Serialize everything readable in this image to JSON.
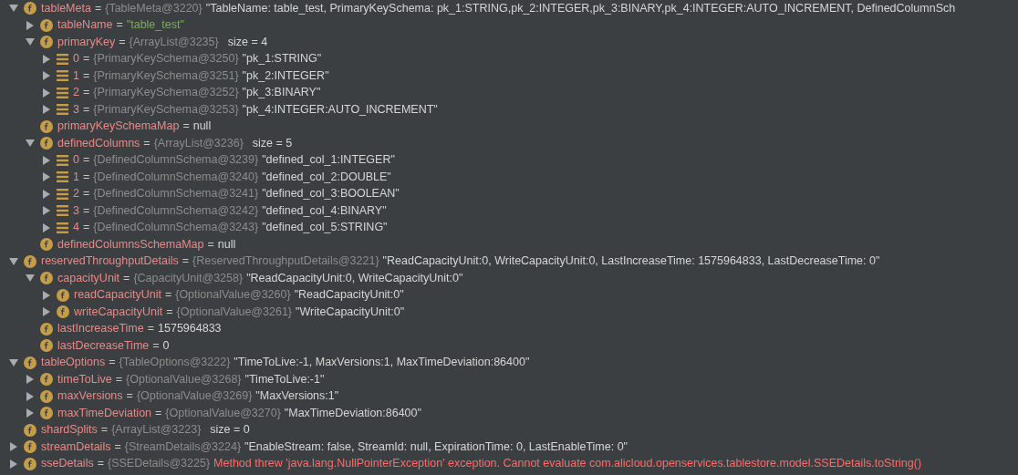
{
  "variables": [
    {
      "name": "tableMeta",
      "kind": "field",
      "expanded": true,
      "separator": "=",
      "type": "{TableMeta@3220}",
      "value": {
        "kind": "string",
        "text": "\"TableName: table_test, PrimaryKeySchema: pk_1:STRING,pk_2:INTEGER,pk_3:BINARY,pk_4:INTEGER:AUTO_INCREMENT, DefinedColumnSch"
      },
      "children": [
        {
          "name": "tableName",
          "kind": "field",
          "expanded": false,
          "separator": "=",
          "value": {
            "kind": "literal",
            "text": "\"table_test\""
          }
        },
        {
          "name": "primaryKey",
          "kind": "field",
          "expanded": true,
          "separator": "=",
          "type": "{ArrayList@3235}",
          "value": {
            "kind": "size",
            "text": "size = 4"
          },
          "children": [
            {
              "name": "0",
              "kind": "item",
              "expanded": false,
              "separator": "=",
              "type": "{PrimaryKeySchema@3250}",
              "value": {
                "kind": "string",
                "text": "\"pk_1:STRING\""
              }
            },
            {
              "name": "1",
              "kind": "item",
              "expanded": false,
              "separator": "=",
              "type": "{PrimaryKeySchema@3251}",
              "value": {
                "kind": "string",
                "text": "\"pk_2:INTEGER\""
              }
            },
            {
              "name": "2",
              "kind": "item",
              "expanded": false,
              "separator": "=",
              "type": "{PrimaryKeySchema@3252}",
              "value": {
                "kind": "string",
                "text": "\"pk_3:BINARY\""
              }
            },
            {
              "name": "3",
              "kind": "item",
              "expanded": false,
              "separator": "=",
              "type": "{PrimaryKeySchema@3253}",
              "value": {
                "kind": "string",
                "text": "\"pk_4:INTEGER:AUTO_INCREMENT\""
              }
            }
          ]
        },
        {
          "name": "primaryKeySchemaMap",
          "kind": "field",
          "separator": "=",
          "value": {
            "kind": "plain",
            "text": "null"
          }
        },
        {
          "name": "definedColumns",
          "kind": "field",
          "expanded": true,
          "separator": "=",
          "type": "{ArrayList@3236}",
          "value": {
            "kind": "size",
            "text": "size = 5"
          },
          "children": [
            {
              "name": "0",
              "kind": "item",
              "expanded": false,
              "separator": "=",
              "type": "{DefinedColumnSchema@3239}",
              "value": {
                "kind": "string",
                "text": "\"defined_col_1:INTEGER\""
              }
            },
            {
              "name": "1",
              "kind": "item",
              "expanded": false,
              "separator": "=",
              "type": "{DefinedColumnSchema@3240}",
              "value": {
                "kind": "string",
                "text": "\"defined_col_2:DOUBLE\""
              }
            },
            {
              "name": "2",
              "kind": "item",
              "expanded": false,
              "separator": "=",
              "type": "{DefinedColumnSchema@3241}",
              "value": {
                "kind": "string",
                "text": "\"defined_col_3:BOOLEAN\""
              }
            },
            {
              "name": "3",
              "kind": "item",
              "expanded": false,
              "separator": "=",
              "type": "{DefinedColumnSchema@3242}",
              "value": {
                "kind": "string",
                "text": "\"defined_col_4:BINARY\""
              }
            },
            {
              "name": "4",
              "kind": "item",
              "expanded": false,
              "separator": "=",
              "type": "{DefinedColumnSchema@3243}",
              "value": {
                "kind": "string",
                "text": "\"defined_col_5:STRING\""
              }
            }
          ]
        },
        {
          "name": "definedColumnsSchemaMap",
          "kind": "field",
          "separator": "=",
          "value": {
            "kind": "plain",
            "text": "null"
          }
        }
      ]
    },
    {
      "name": "reservedThroughputDetails",
      "kind": "field",
      "expanded": true,
      "separator": "=",
      "type": "{ReservedThroughputDetails@3221}",
      "value": {
        "kind": "string",
        "text": "\"ReadCapacityUnit:0, WriteCapacityUnit:0, LastIncreaseTime: 1575964833, LastDecreaseTime: 0\""
      },
      "children": [
        {
          "name": "capacityUnit",
          "kind": "field",
          "expanded": true,
          "separator": "=",
          "type": "{CapacityUnit@3258}",
          "value": {
            "kind": "string",
            "text": "\"ReadCapacityUnit:0, WriteCapacityUnit:0\""
          },
          "children": [
            {
              "name": "readCapacityUnit",
              "kind": "field",
              "expanded": false,
              "separator": "=",
              "type": "{OptionalValue@3260}",
              "value": {
                "kind": "string",
                "text": "\"ReadCapacityUnit:0\""
              }
            },
            {
              "name": "writeCapacityUnit",
              "kind": "field",
              "expanded": false,
              "separator": "=",
              "type": "{OptionalValue@3261}",
              "value": {
                "kind": "string",
                "text": "\"WriteCapacityUnit:0\""
              }
            }
          ]
        },
        {
          "name": "lastIncreaseTime",
          "kind": "field",
          "separator": "=",
          "value": {
            "kind": "plain",
            "text": "1575964833"
          }
        },
        {
          "name": "lastDecreaseTime",
          "kind": "field",
          "separator": "=",
          "value": {
            "kind": "plain",
            "text": "0"
          }
        }
      ]
    },
    {
      "name": "tableOptions",
      "kind": "field",
      "expanded": true,
      "separator": "=",
      "type": "{TableOptions@3222}",
      "value": {
        "kind": "string",
        "text": "\"TimeToLive:-1, MaxVersions:1, MaxTimeDeviation:86400\""
      },
      "children": [
        {
          "name": "timeToLive",
          "kind": "field",
          "expanded": false,
          "separator": "=",
          "type": "{OptionalValue@3268}",
          "value": {
            "kind": "string",
            "text": "\"TimeToLive:-1\""
          }
        },
        {
          "name": "maxVersions",
          "kind": "field",
          "expanded": false,
          "separator": "=",
          "type": "{OptionalValue@3269}",
          "value": {
            "kind": "string",
            "text": "\"MaxVersions:1\""
          }
        },
        {
          "name": "maxTimeDeviation",
          "kind": "field",
          "expanded": false,
          "separator": "=",
          "type": "{OptionalValue@3270}",
          "value": {
            "kind": "string",
            "text": "\"MaxTimeDeviation:86400\""
          }
        }
      ]
    },
    {
      "name": "shardSplits",
      "kind": "field",
      "separator": "=",
      "type": "{ArrayList@3223}",
      "value": {
        "kind": "size",
        "text": "size = 0"
      }
    },
    {
      "name": "streamDetails",
      "kind": "field",
      "expanded": false,
      "separator": "=",
      "type": "{StreamDetails@3224}",
      "value": {
        "kind": "string",
        "text": "\"EnableStream: false, StreamId: null, ExpirationTime: 0, LastEnableTime: 0\""
      }
    },
    {
      "name": "sseDetails",
      "kind": "field",
      "expanded": false,
      "separator": "=",
      "type": "{SSEDetails@3225}",
      "value": {
        "kind": "error",
        "text": "Method threw 'java.lang.NullPointerException' exception. Cannot evaluate com.alicloud.openservices.tablestore.model.SSEDetails.toString()"
      }
    }
  ]
}
